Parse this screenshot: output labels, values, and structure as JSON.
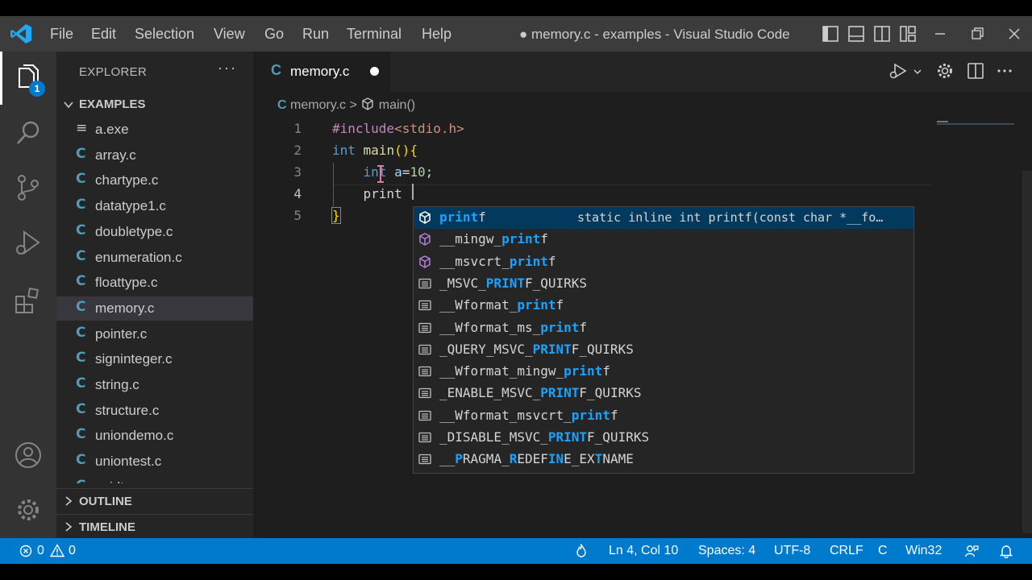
{
  "window": {
    "title": "● memory.c - examples - Visual Studio Code",
    "menu": [
      "File",
      "Edit",
      "Selection",
      "View",
      "Go",
      "Run",
      "Terminal",
      "Help"
    ]
  },
  "activity": {
    "explorer_badge": "1"
  },
  "sidebar": {
    "title": "EXPLORER",
    "more": "···",
    "folder": "EXAMPLES",
    "files": [
      {
        "icon": "≡",
        "name": "a.exe"
      },
      {
        "icon": "C",
        "name": "array.c"
      },
      {
        "icon": "C",
        "name": "chartype.c"
      },
      {
        "icon": "C",
        "name": "datatype1.c"
      },
      {
        "icon": "C",
        "name": "doubletype.c"
      },
      {
        "icon": "C",
        "name": "enumeration.c"
      },
      {
        "icon": "C",
        "name": "floattype.c"
      },
      {
        "icon": "C",
        "name": "memory.c"
      },
      {
        "icon": "C",
        "name": "pointer.c"
      },
      {
        "icon": "C",
        "name": "signinteger.c"
      },
      {
        "icon": "C",
        "name": "string.c"
      },
      {
        "icon": "C",
        "name": "structure.c"
      },
      {
        "icon": "C",
        "name": "uniondemo.c"
      },
      {
        "icon": "C",
        "name": "uniontest.c"
      },
      {
        "icon": "C",
        "name": "voidtype.c"
      }
    ],
    "selected_file": "memory.c",
    "outline": "OUTLINE",
    "timeline": "TIMELINE"
  },
  "editor": {
    "tab": {
      "icon": "C",
      "label": "memory.c"
    },
    "breadcrumb": {
      "file_icon": "C",
      "file": "memory.c",
      "sep": ">",
      "symbol": "main()"
    },
    "line_numbers": [
      "1",
      "2",
      "3",
      "4",
      "5"
    ],
    "lines": [
      {
        "a": "#include",
        "b": "<stdio.h>"
      },
      {
        "a": "int",
        "b": "main",
        "c": "(){"
      },
      {
        "a": "int",
        "b": "a",
        "c": "=",
        "d": "10",
        "e": ";"
      },
      {
        "a": "print"
      },
      {
        "a": "}"
      }
    ]
  },
  "suggest": {
    "detail": "static inline int printf(const char *__fo…",
    "items": [
      {
        "kind": "method",
        "pre": "",
        "match": "print",
        "post": "f"
      },
      {
        "kind": "method",
        "pre": "__mingw_",
        "match": "print",
        "post": "f"
      },
      {
        "kind": "method",
        "pre": "__msvcrt_",
        "match": "print",
        "post": "f"
      },
      {
        "kind": "text",
        "pre": "_MSVC_",
        "match": "PRINT",
        "post": "F_QUIRKS"
      },
      {
        "kind": "text",
        "pre": "__Wformat_",
        "match": "print",
        "post": "f"
      },
      {
        "kind": "text",
        "pre": "__Wformat_ms_",
        "match": "print",
        "post": "f"
      },
      {
        "kind": "text",
        "pre": "_QUERY_MSVC_",
        "match": "PRINT",
        "post": "F_QUIRKS"
      },
      {
        "kind": "text",
        "pre": "__Wformat_mingw_",
        "match": "print",
        "post": "f"
      },
      {
        "kind": "text",
        "pre": "_ENABLE_MSVC_",
        "match": "PRINT",
        "post": "F_QUIRKS"
      },
      {
        "kind": "text",
        "pre": "__Wformat_msvcrt_",
        "match": "print",
        "post": "f"
      },
      {
        "kind": "text",
        "pre": "_DISABLE_MSVC_",
        "match": "PRINT",
        "post": "F_QUIRKS"
      },
      {
        "kind": "text",
        "pre": "__",
        "match": "P",
        "post": "RAGMA_",
        "m2": "R",
        "p2": "EDEF",
        "m3": "IN",
        "p3": "E_EX",
        "m4": "T",
        "p4": "NAME"
      }
    ]
  },
  "status": {
    "errors": "0",
    "warnings": "0",
    "position": "Ln 4, Col 10",
    "spaces": "Spaces: 4",
    "encoding": "UTF-8",
    "eol": "CRLF",
    "language": "C",
    "platform": "Win32"
  },
  "colors": {
    "accent": "#007acc",
    "suggest_match": "#18a3ff",
    "c_icon": "#519aba"
  }
}
